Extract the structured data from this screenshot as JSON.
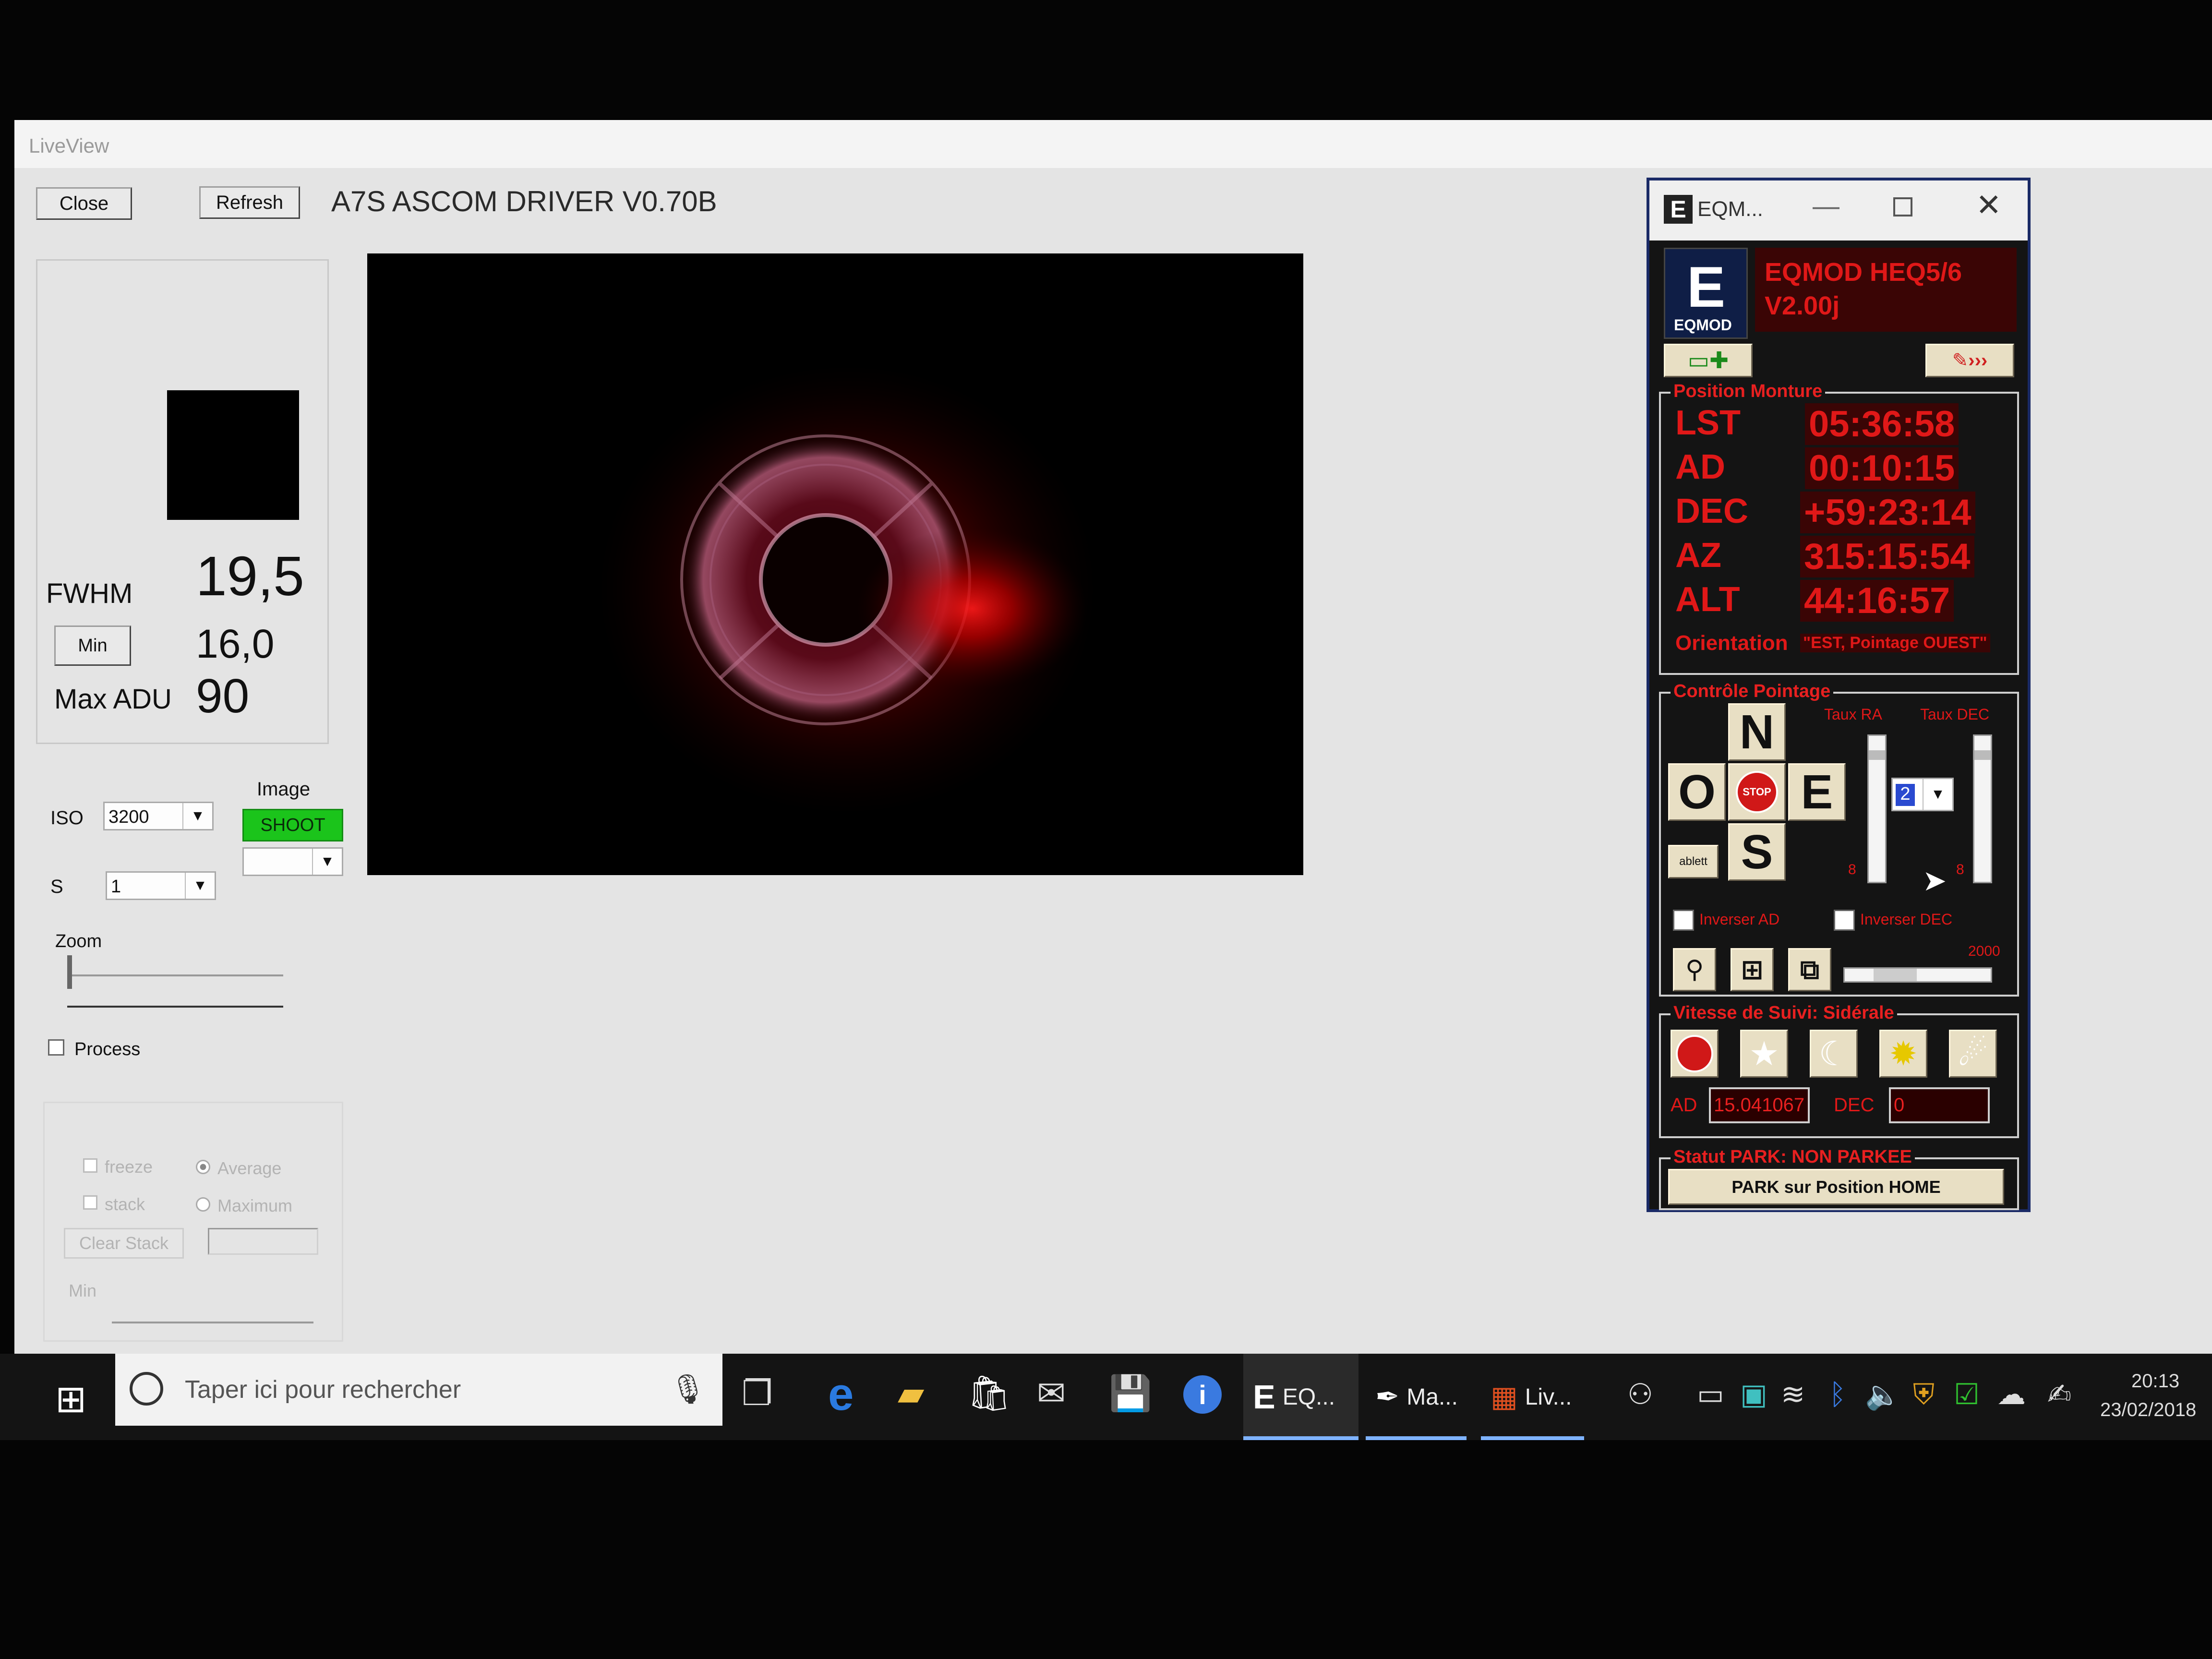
{
  "liveview": {
    "window_title": "LiveView",
    "close_label": "Close",
    "refresh_label": "Refresh",
    "driver_title": "A7S ASCOM DRIVER V0.70B",
    "fwhm_label": "FWHM",
    "fwhm_value": "19,5",
    "min_label": "Min",
    "min_value": "16,0",
    "maxadu_label": "Max ADU",
    "maxadu_value": "90",
    "iso_label": "ISO",
    "iso_value": "3200",
    "s_label": "S",
    "s_value": "1",
    "image_label": "Image",
    "shoot_label": "SHOOT",
    "zoom_label": "Zoom",
    "process_label": "Process",
    "freeze_label": "freeze",
    "stack_label": "stack",
    "average_label": "Average",
    "maximum_label": "Maximum",
    "clear_stack_label": "Clear Stack",
    "bottom_min_label": "Min"
  },
  "eqmod": {
    "window_title": "EQM...",
    "logo_text": "EQMOD",
    "version_line1": "EQMOD HEQ5/6",
    "version_line2": "V2.00j",
    "position_group": "Position Monture",
    "lst_label": "LST",
    "lst_value": "05:36:58",
    "ad_label": "AD",
    "ad_value": "00:10:15",
    "dec_label": "DEC",
    "dec_value": "+59:23:14",
    "az_label": "AZ",
    "az_value": "315:15:54",
    "alt_label": "ALT",
    "alt_value": "44:16:57",
    "orientation_label": "Orientation",
    "orientation_value": "\"EST, Pointage OUEST\"",
    "control_group": "Contrôle Pointage",
    "taux_ra": "Taux RA",
    "taux_dec": "Taux DEC",
    "north": "N",
    "west": "O",
    "east": "E",
    "south": "S",
    "stop": "STOP",
    "tablet": "ablett",
    "rate_value": "2",
    "ra_slider_value": "8",
    "dec_slider_value": "8",
    "invert_ad": "Inverser AD",
    "invert_dec": "Inverser DEC",
    "speed_value": "2000",
    "tracking_group": "Vitesse de Suivi: Sidérale",
    "track_ad_label": "AD",
    "track_ad_value": "15.041067",
    "track_dec_label": "DEC",
    "track_dec_value": "0",
    "park_group": "Statut PARK: NON PARKEE",
    "park_button": "PARK sur Position HOME"
  },
  "taskbar": {
    "search_placeholder": "Taper ici pour rechercher",
    "app_eq": "EQ...",
    "app_ma": "Ma...",
    "app_liv": "Liv...",
    "time": "20:13",
    "date": "23/02/2018"
  },
  "colors": {
    "shoot_green": "#1bc41b",
    "eqmod_red": "#e01818",
    "taskbar_accent": "#7eb3ff"
  }
}
